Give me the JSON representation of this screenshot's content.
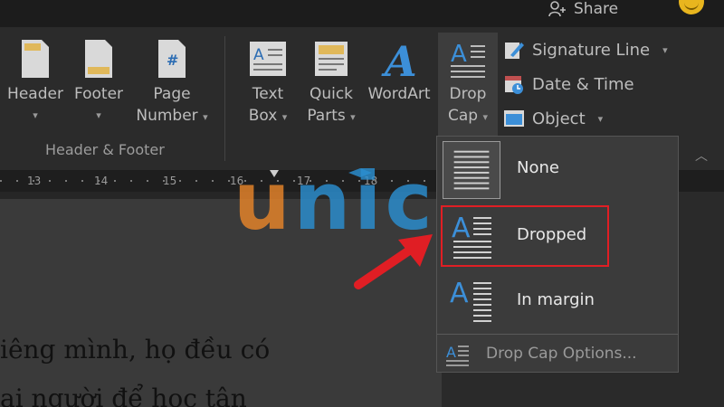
{
  "top": {
    "share_label": "Share"
  },
  "ribbon": {
    "header": {
      "label_line1": "Header",
      "caret": "▾"
    },
    "footer": {
      "label_line1": "Footer",
      "caret": "▾"
    },
    "page_number": {
      "label_line1": "Page",
      "label_line2": "Number",
      "caret": "▾"
    },
    "group_label": "Header & Footer",
    "text_box": {
      "label_line1": "Text",
      "label_line2": "Box",
      "caret": "▾"
    },
    "quick_parts": {
      "label_line1": "Quick",
      "label_line2": "Parts",
      "caret": "▾"
    },
    "wordart": {
      "label_line1": "WordArt"
    },
    "drop_cap": {
      "label_line1": "Drop",
      "label_line2": "Cap",
      "caret": "▾"
    },
    "signature_line": {
      "label": "Signature Line",
      "caret": "▾"
    },
    "date_time": {
      "label": "Date & Time"
    },
    "object": {
      "label": "Object",
      "caret": "▾"
    }
  },
  "ruler": {
    "ticks": [
      "13",
      "14",
      "15",
      "16",
      "17",
      "18"
    ]
  },
  "document": {
    "line1": "iêng mình, họ đều có",
    "line2": "ai người để học tận"
  },
  "watermark": {
    "u": "u",
    "rest": "nica"
  },
  "drop_cap_menu": {
    "items": [
      {
        "label": "None"
      },
      {
        "label": "Dropped"
      },
      {
        "label": "In margin"
      }
    ],
    "options_label": "Drop Cap Options..."
  },
  "colors": {
    "highlight": "#e01e24",
    "arrow": "#e01e24",
    "accent_blue": "#2b8fd1",
    "accent_orange": "#e8852a"
  }
}
